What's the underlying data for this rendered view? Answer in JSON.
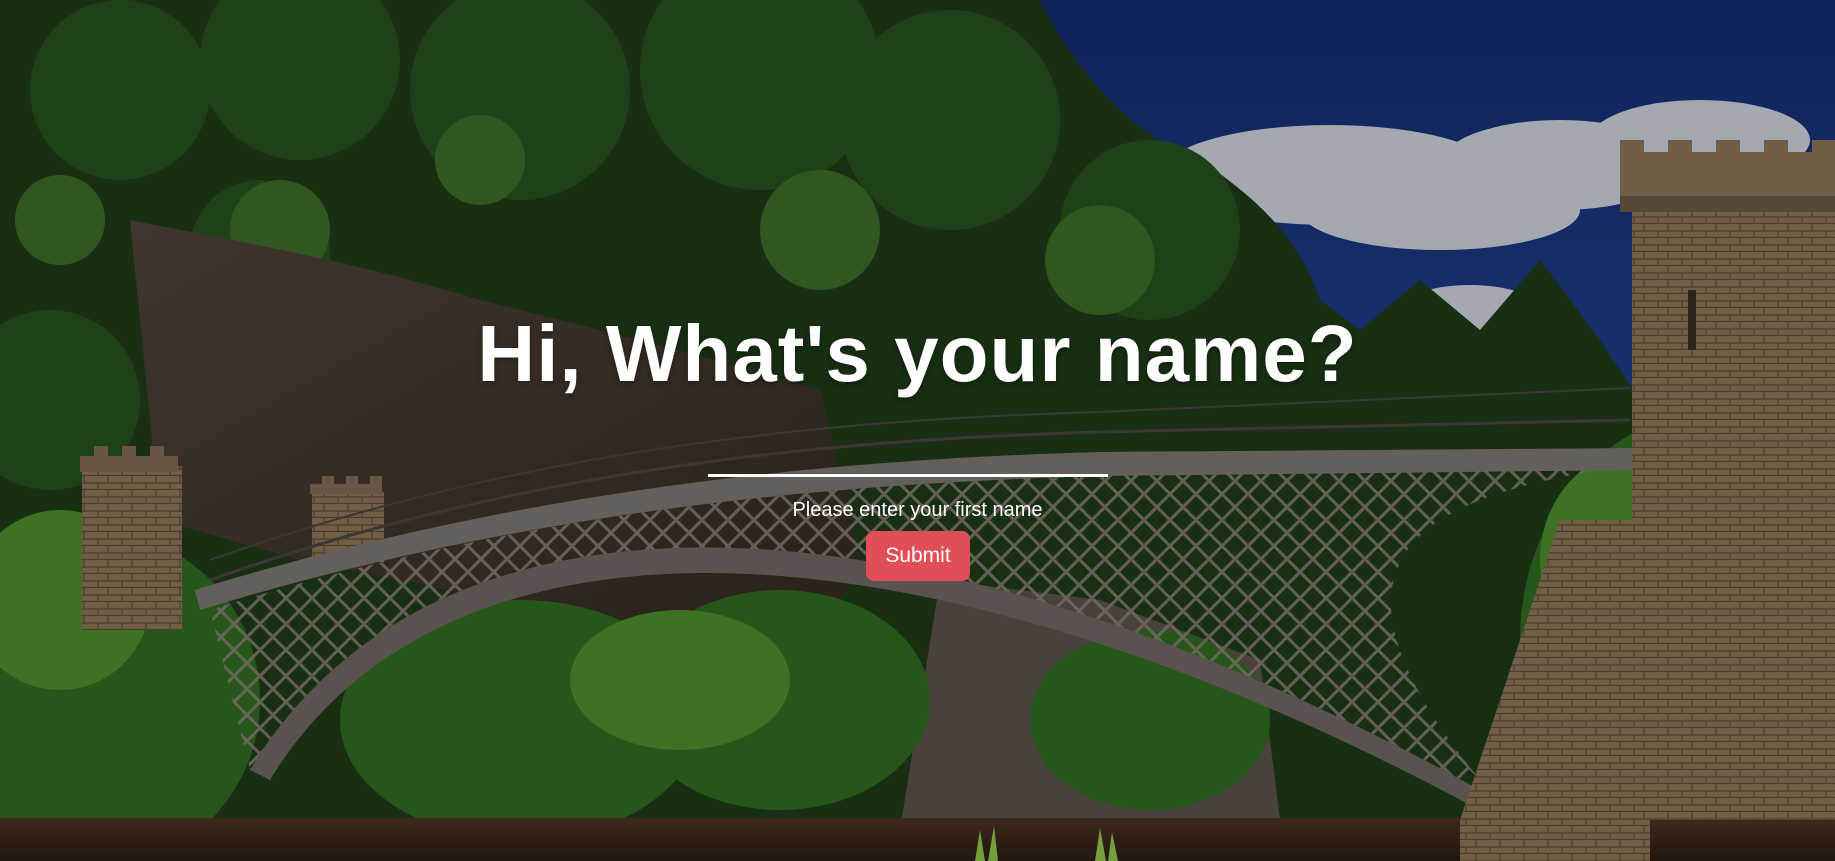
{
  "greeting": {
    "heading": "Hi, What's your name?",
    "input_value": "",
    "input_placeholder": "",
    "helper_text": "Please enter your first name",
    "submit_label": "Submit"
  },
  "colors": {
    "submit_button": "#e04e57",
    "text": "#ffffff",
    "sky": "#1f3a86",
    "foliage": "#2f5a22",
    "river": "#3b2a1c"
  },
  "background": {
    "scene": "iron-arch-bridge-over-river-with-castle-towers-and-forest"
  }
}
